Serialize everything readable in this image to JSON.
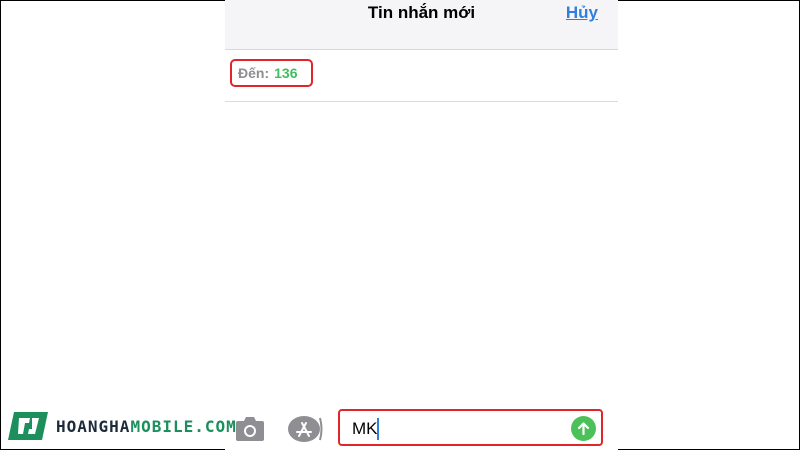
{
  "header": {
    "title": "Tin nhắn mới",
    "cancel_label": "Hủy"
  },
  "recipient": {
    "label": "Đến:",
    "value": "136"
  },
  "composer": {
    "text": "MK"
  },
  "watermark": {
    "brand_part1": "HOANGHA",
    "brand_part2": "MOBILE.COM"
  },
  "icons": {
    "camera": "camera-icon",
    "apps": "app-store-icon",
    "send": "send-arrow-icon"
  },
  "colors": {
    "link": "#2f7fe0",
    "recipient": "#3fbf5f",
    "send": "#4cc15a",
    "highlight": "#e0252b"
  }
}
